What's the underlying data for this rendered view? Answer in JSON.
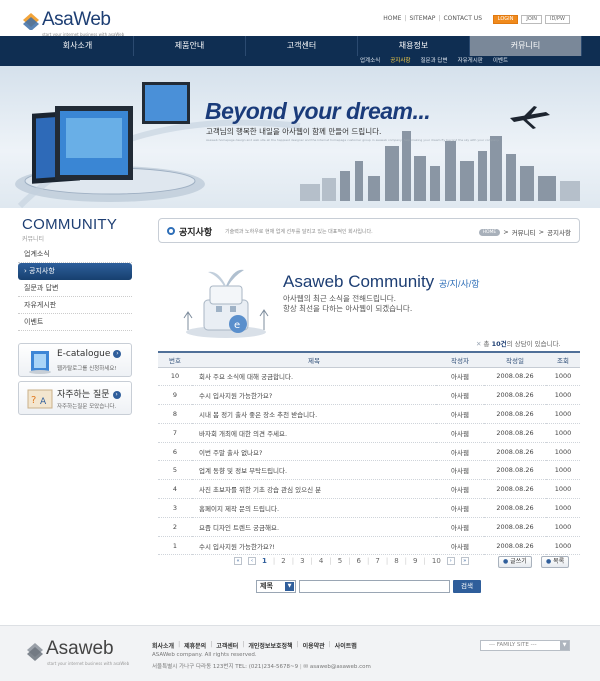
{
  "brand": {
    "name_a": "Asa",
    "name_b": "Web",
    "tagline": "start your internet business with asaWeb"
  },
  "top_links": [
    "HOME",
    "SITEMAP",
    "CONTACT US"
  ],
  "top_buttons": [
    "LOGIN",
    "JOIN",
    "ID/PW"
  ],
  "nav": {
    "items": [
      "회사소개",
      "제품안내",
      "고객센터",
      "채용정보",
      "커뮤니티"
    ],
    "active_index": 4
  },
  "subnav": {
    "items": [
      "업계소식",
      "공지사항",
      "질문과 답변",
      "자유게시판",
      "이벤트"
    ],
    "active_index": 1
  },
  "hero": {
    "slogan": "Beyond your dream...",
    "sub": "고객님의 행복한 내일을 아사웹이 함께 만들어 드립니다.",
    "fine": "Asaweb homepage design and web site all the happiest designer and the Internet homepage customer group in asaweb company, help making your dream fly beyond the sky with your company."
  },
  "sidebar": {
    "title": "COMMUNITY",
    "subtitle": "커뮤니티",
    "items": [
      "업계소식",
      "공지사항",
      "질문과 답변",
      "자유게시판",
      "이벤트"
    ],
    "active_index": 1,
    "promo1": {
      "title": "E-catalogue",
      "desc": "웹카탈로그를 신청하세요!"
    },
    "promo2": {
      "title": "자주하는 질문",
      "desc": "자주하는질문 모았습니다."
    }
  },
  "page": {
    "title": "공지사항",
    "desc": "기술력과 노하우로 현재 업계 선두를 달리고 있는 대표적인 회사입니다.",
    "breadcrumb": {
      "home": "HOME",
      "items": [
        "커뮤니티",
        "공지사항"
      ],
      "sep": ">"
    }
  },
  "intro": {
    "title": "Asaweb Community",
    "title_sub": "공/지/사/항",
    "line1": "아사웹의 최근 소식을 전해드립니다.",
    "line2": "항상 최선을 다하는 아사웹이 되겠습니다."
  },
  "count": {
    "prefix": "총",
    "value": "10건",
    "suffix": "의 상담이 있습니다."
  },
  "table": {
    "headers": [
      "번호",
      "제목",
      "작성자",
      "작성일",
      "조회"
    ],
    "rows": [
      [
        "10",
        "회사 주요 소식에 대해 궁금합니다.",
        "아사웹",
        "2008.08.26",
        "1000"
      ],
      [
        "9",
        "수시 입사지원 가능한가요?",
        "아사웹",
        "2008.08.26",
        "1000"
      ],
      [
        "8",
        "시내 봄 정기 출사 좋은 장소 추천 받습니다.",
        "아사웹",
        "2008.08.26",
        "1000"
      ],
      [
        "7",
        "바자회 개최에 대한 의견 주세요.",
        "아사웹",
        "2008.08.26",
        "1000"
      ],
      [
        "6",
        "이번 주말 출사 없나요?",
        "아사웹",
        "2008.08.26",
        "1000"
      ],
      [
        "5",
        "업계 동향 및 정보 부탁드립니다.",
        "아사웹",
        "2008.08.26",
        "1000"
      ],
      [
        "4",
        "사진 초보자를 위한 기초 강습 관심 있으신 분",
        "아사웹",
        "2008.08.26",
        "1000"
      ],
      [
        "3",
        "홈페이지 제작 문의 드립니다.",
        "아사웹",
        "2008.08.26",
        "1000"
      ],
      [
        "2",
        "요즘 디자인 트렌드 궁금해요.",
        "아사웹",
        "2008.08.26",
        "1000"
      ],
      [
        "1",
        "수시 입사지원 가능한가요?!",
        "아사웹",
        "2008.08.26",
        "1000"
      ]
    ]
  },
  "pager": {
    "pages": [
      "1",
      "2",
      "3",
      "4",
      "5",
      "6",
      "7",
      "8",
      "9",
      "10"
    ],
    "current": "1",
    "first": "«",
    "prev": "‹",
    "next": "›",
    "last": "»"
  },
  "actions": {
    "write": "글쓰기",
    "list": "목록"
  },
  "search": {
    "select": "제목",
    "value": "",
    "button": "검색"
  },
  "footer": {
    "links": [
      "회사소개",
      "제휴문의",
      "고객센터",
      "개인정보보호정책",
      "이용약관",
      "사이트맵"
    ],
    "copyright": "ASAWeb company. All rights reserved.",
    "address": "서울특별시 가나구 다라동 123번지  TEL: (021)234-5678~9",
    "email": "asaweb@asaweb.com",
    "family": "--- FAMILY SITE ---"
  }
}
